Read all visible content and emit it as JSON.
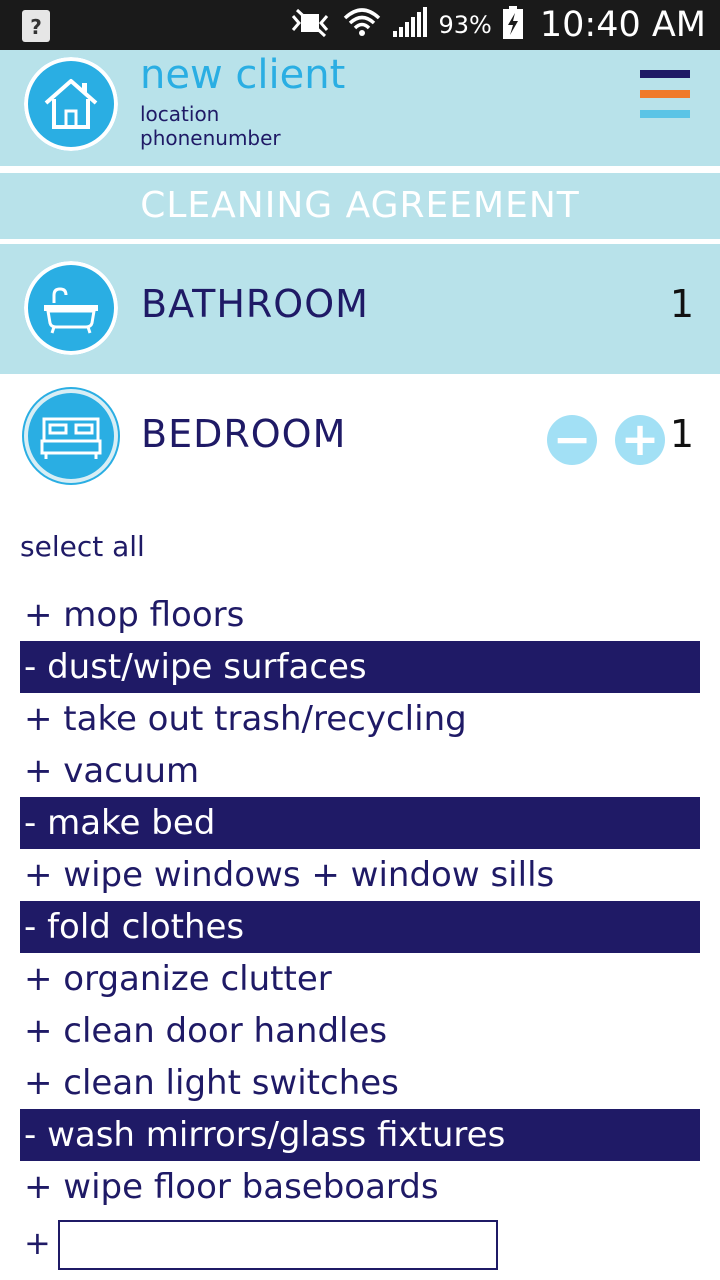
{
  "statusbar": {
    "left_icon": "?",
    "battery_percent": "93%",
    "time": "10:40 AM",
    "icons": [
      "mute-icon",
      "wifi-icon",
      "signal-icon",
      "battery-charging-icon"
    ]
  },
  "client": {
    "name": "new client",
    "location": "location",
    "phone": "phonenumber",
    "avatar_icon": "house-icon"
  },
  "menu": {
    "icon": "hamburger-menu-icon",
    "colors": [
      "#1f1a66",
      "#f07a2a",
      "#5bc4e6"
    ]
  },
  "agreement_title": "CLEANING AGREEMENT",
  "rooms": [
    {
      "label": "BATHROOM",
      "count": "1",
      "icon": "bathtub-icon"
    },
    {
      "label": "BEDROOM",
      "count": "1",
      "icon": "bed-icon",
      "minus": "−",
      "plus": "+"
    }
  ],
  "select_all": "select all",
  "tasks": [
    {
      "text": "+ mop floors",
      "selected": false
    },
    {
      "text": "- dust/wipe surfaces",
      "selected": true
    },
    {
      "text": "+ take out trash/recycling",
      "selected": false
    },
    {
      "text": "+ vacuum",
      "selected": false
    },
    {
      "text": "- make bed",
      "selected": true
    },
    {
      "text": "+ wipe windows + window sills",
      "selected": false
    },
    {
      "text": "- fold clothes",
      "selected": true
    },
    {
      "text": "+ organize clutter",
      "selected": false
    },
    {
      "text": "+ clean door handles",
      "selected": false
    },
    {
      "text": "+ clean light switches",
      "selected": false
    },
    {
      "text": "- wash mirrors/glass fixtures",
      "selected": true
    },
    {
      "text": "+ wipe floor baseboards",
      "selected": false
    }
  ],
  "add_task": {
    "plus": "+",
    "value": "",
    "placeholder": ""
  },
  "colors": {
    "accent": "#2aaee3",
    "header_bg": "#b8e2ea",
    "navy": "#1f1a66",
    "button_light": "#a2e0f5"
  }
}
